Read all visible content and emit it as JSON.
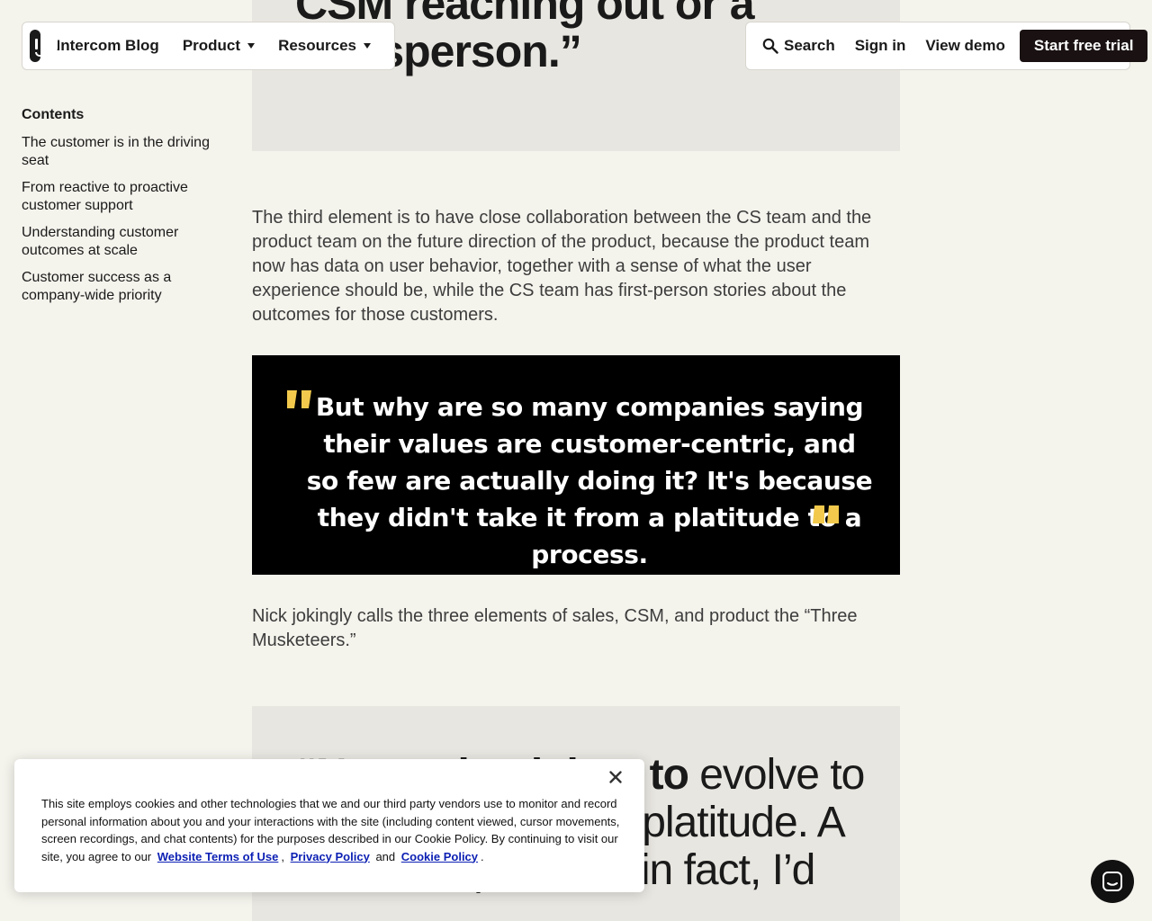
{
  "colors": {
    "page_bg": "#f4f3ec",
    "pull_quote_bg": "#e8e6e0",
    "quote_card_bg": "#000000",
    "quote_mark": "#f2c94c",
    "cta_bg": "#1a1212",
    "link_blue": "#0b1fb3"
  },
  "nav": {
    "brand": "Intercom Blog",
    "product": "Product",
    "resources": "Resources",
    "search": "Search",
    "sign_in": "Sign in",
    "view_demo": "View demo",
    "cta": "Start free trial"
  },
  "toc": {
    "title": "Contents",
    "items": [
      "The customer is in the driving seat",
      "From reactive to proactive customer support",
      "Understanding customer outcomes at scale",
      "Customer success as a company-wide priority"
    ]
  },
  "article": {
    "pull_quote_top": "CSM reaching out or a salesperson.”",
    "paragraph_1": "The third element is to have close collaboration between the CS team and the product team on the future direction of the product, because the product team now has data on user behavior, together with a sense of what the user experience should be, while the CS team has first-person stories about the outcomes for those customers.",
    "quote_card": "But why are so many companies saying their values are customer-centric, and so few are actually doing it? It's because they didn't take it from a platitude to a process.",
    "paragraph_2": "Nick jokingly calls the three elements of sales, CSM, and product the “Three Musketeers.”",
    "pull_quote_bottom_bold": "“Now, what it has to",
    "pull_quote_bottom_rest": " evolve to is, it can’t just be a platitude. A lot of companies – in fact, I’d"
  },
  "cookie": {
    "text": "This site employs cookies and other technologies that we and our third party vendors use to monitor and record personal information about you and your interactions with the site (including content viewed, cursor movements, screen recordings, and chat contents) for the purposes described in our Cookie Policy. By continuing to visit our site, you agree to our",
    "terms": "Website Terms of Use",
    "sep": ",",
    "privacy": "Privacy Policy",
    "and": "and",
    "cookie_policy": "Cookie Policy",
    "end": "."
  },
  "icons": {
    "logo": "intercom-logo-icon",
    "search": "search-icon",
    "close": "close-icon",
    "chat": "chat-icon"
  }
}
